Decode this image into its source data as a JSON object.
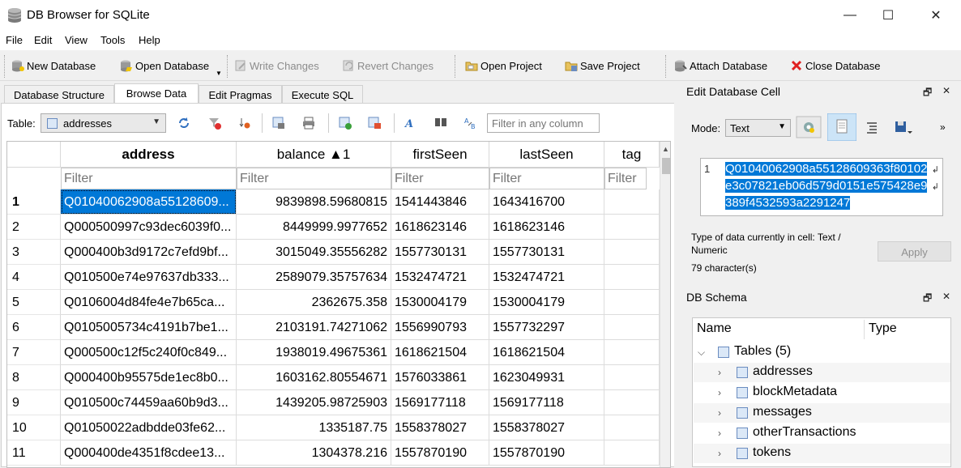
{
  "window": {
    "title": "DB Browser for SQLite",
    "minimize": "—",
    "maximize": "☐",
    "close": "✕"
  },
  "menu": [
    "File",
    "Edit",
    "View",
    "Tools",
    "Help"
  ],
  "toolbar": {
    "new_database": "New Database",
    "open_database": "Open Database",
    "write_changes": "Write Changes",
    "revert_changes": "Revert Changes",
    "open_project": "Open Project",
    "save_project": "Save Project",
    "attach_database": "Attach Database",
    "close_database": "Close Database"
  },
  "tabs": [
    "Database Structure",
    "Browse Data",
    "Edit Pragmas",
    "Execute SQL"
  ],
  "browse": {
    "table_label": "Table:",
    "table_value": "addresses",
    "filter_any_placeholder": "Filter in any column",
    "columns": [
      "address",
      "balance ▲1",
      "firstSeen",
      "lastSeen",
      "tag"
    ],
    "filter_placeholder": "Filter",
    "rows": [
      {
        "n": "1",
        "address": "Q01040062908a55128609...",
        "balance": "9839898.59680815",
        "firstSeen": "1541443846",
        "lastSeen": "1643416700",
        "tag": ""
      },
      {
        "n": "2",
        "address": "Q000500997c93dec6039f0...",
        "balance": "8449999.9977652",
        "firstSeen": "1618623146",
        "lastSeen": "1618623146",
        "tag": ""
      },
      {
        "n": "3",
        "address": "Q000400b3d9172c7efd9bf...",
        "balance": "3015049.35556282",
        "firstSeen": "1557730131",
        "lastSeen": "1557730131",
        "tag": ""
      },
      {
        "n": "4",
        "address": "Q010500e74e97637db333...",
        "balance": "2589079.35757634",
        "firstSeen": "1532474721",
        "lastSeen": "1532474721",
        "tag": ""
      },
      {
        "n": "5",
        "address": "Q0106004d84fe4e7b65ca...",
        "balance": "2362675.358",
        "firstSeen": "1530004179",
        "lastSeen": "1530004179",
        "tag": ""
      },
      {
        "n": "6",
        "address": "Q0105005734c4191b7be1...",
        "balance": "2103191.74271062",
        "firstSeen": "1556990793",
        "lastSeen": "1557732297",
        "tag": ""
      },
      {
        "n": "7",
        "address": "Q000500c12f5c240f0c849...",
        "balance": "1938019.49675361",
        "firstSeen": "1618621504",
        "lastSeen": "1618621504",
        "tag": ""
      },
      {
        "n": "8",
        "address": "Q000400b95575de1ec8b0...",
        "balance": "1603162.80554671",
        "firstSeen": "1576033861",
        "lastSeen": "1623049931",
        "tag": ""
      },
      {
        "n": "9",
        "address": "Q010500c74459aa60b9d3...",
        "balance": "1439205.98725903",
        "firstSeen": "1569177118",
        "lastSeen": "1569177118",
        "tag": ""
      },
      {
        "n": "10",
        "address": "Q01050022adbdde03fe62...",
        "balance": "1335187.75",
        "firstSeen": "1558378027",
        "lastSeen": "1558378027",
        "tag": ""
      },
      {
        "n": "11",
        "address": "Q000400de4351f8cdee13...",
        "balance": "1304378.216",
        "firstSeen": "1557870190",
        "lastSeen": "1557870190",
        "tag": ""
      }
    ]
  },
  "edit_cell": {
    "title": "Edit Database Cell",
    "mode_label": "Mode:",
    "mode_value": "Text",
    "line_no": "1",
    "value": "Q01040062908a55128609363f80102e3c07821eb06d579d0151e575428e9389f4532593a2291247",
    "type_text": "Type of data currently in cell: Text / Numeric",
    "char_count": "79 character(s)",
    "apply": "Apply"
  },
  "schema": {
    "title": "DB Schema",
    "col_name": "Name",
    "col_type": "Type",
    "tables_label": "Tables (5)",
    "tables": [
      "addresses",
      "blockMetadata",
      "messages",
      "otherTransactions",
      "tokens"
    ]
  },
  "colors": {
    "selection": "#0078d7",
    "window_bg": "#f0f0f0"
  }
}
